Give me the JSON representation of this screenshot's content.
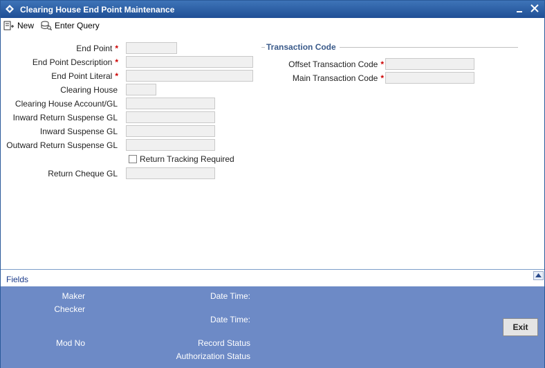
{
  "window": {
    "title": "Clearing House End Point Maintenance",
    "title_bar_color": "#2a5a9a",
    "icons": {
      "app": "diamond-icon",
      "minimize": "minimize-icon",
      "close": "close-icon"
    }
  },
  "toolbar": {
    "new_label": "New",
    "enter_query_label": "Enter Query",
    "icons": {
      "new": "new-document-icon",
      "enter_query": "query-icon"
    }
  },
  "form": {
    "required_marker": "*",
    "required_color": "#cc0000",
    "end_point": {
      "label": "End Point",
      "value": ""
    },
    "end_point_description": {
      "label": "End Point Description",
      "value": ""
    },
    "end_point_literal": {
      "label": "End Point Literal",
      "value": ""
    },
    "clearing_house": {
      "label": "Clearing House",
      "value": ""
    },
    "clearing_house_account": {
      "label": "Clearing House Account/GL",
      "value": ""
    },
    "inward_return_suspense_gl": {
      "label": "Inward Return Suspense GL",
      "value": ""
    },
    "inward_suspense_gl": {
      "label": "Inward Suspense GL",
      "value": ""
    },
    "outward_return_suspense_gl": {
      "label": "Outward Return Suspense GL",
      "value": ""
    },
    "return_tracking_required": {
      "label": "Return Tracking Required",
      "checked": false
    },
    "return_cheque_gl": {
      "label": "Return Cheque GL",
      "value": ""
    }
  },
  "transaction_code": {
    "section_title": "Transaction Code",
    "offset_transaction_code": {
      "label": "Offset Transaction Code",
      "value": ""
    },
    "main_transaction_code": {
      "label": "Main Transaction Code",
      "value": ""
    }
  },
  "fields_bar": {
    "label": "Fields",
    "collapse_icon": "collapse-up-icon"
  },
  "footer": {
    "background_color": "#6d8ac6",
    "maker_label": "Maker",
    "checker_label": "Checker",
    "date_time_label_1": "Date Time:",
    "date_time_label_2": "Date Time:",
    "mod_no_label": "Mod No",
    "record_status_label": "Record Status",
    "authorization_status_label": "Authorization Status",
    "exit_label": "Exit"
  }
}
